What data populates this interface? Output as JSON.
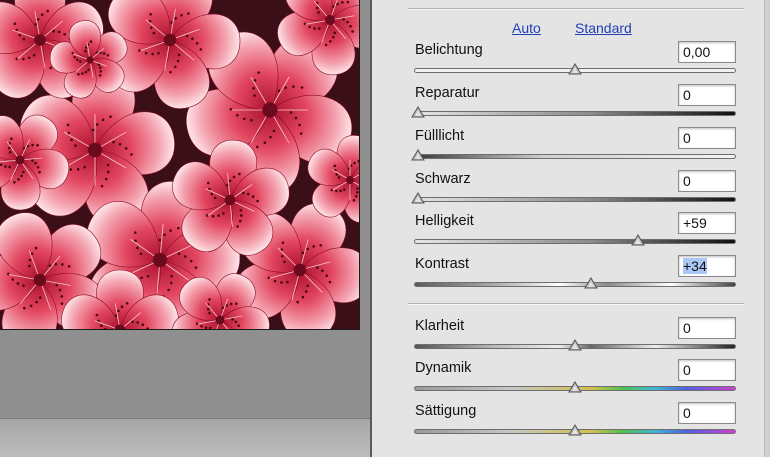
{
  "links": {
    "auto": "Auto",
    "standard": "Standard"
  },
  "controls": [
    {
      "key": "belichtung",
      "label": "Belichtung",
      "value": "0,00",
      "level": 0.5,
      "track": "light"
    },
    {
      "key": "reparatur",
      "label": "Reparatur",
      "value": "0",
      "level": 0.0,
      "track": "dark-right"
    },
    {
      "key": "fuelllicht",
      "label": "Fülllicht",
      "value": "0",
      "level": 0.0,
      "track": "light-right"
    },
    {
      "key": "schwarz",
      "label": "Schwarz",
      "value": "0",
      "level": 0.0,
      "track": "dark-right"
    },
    {
      "key": "helligkeit",
      "label": "Helligkeit",
      "value": "+59",
      "level": 0.7,
      "track": "dark-right"
    },
    {
      "key": "kontrast",
      "label": "Kontrast",
      "value": "+34",
      "level": 0.55,
      "track": "contrast",
      "selected": true
    },
    {
      "key": "klarheit",
      "label": "Klarheit",
      "value": "0",
      "level": 0.5,
      "track": "clarity"
    },
    {
      "key": "dynamik",
      "label": "Dynamik",
      "value": "0",
      "level": 0.5,
      "track": "spectrum"
    },
    {
      "key": "saettigung",
      "label": "Sättigung",
      "value": "0",
      "level": 0.5,
      "track": "spectrum"
    }
  ],
  "colors": {
    "link": "#1f3fb4",
    "panel": "#e4e4e4",
    "selection": "#a9c8f5"
  },
  "image": {
    "subject": "pink-azalea-flowers"
  }
}
